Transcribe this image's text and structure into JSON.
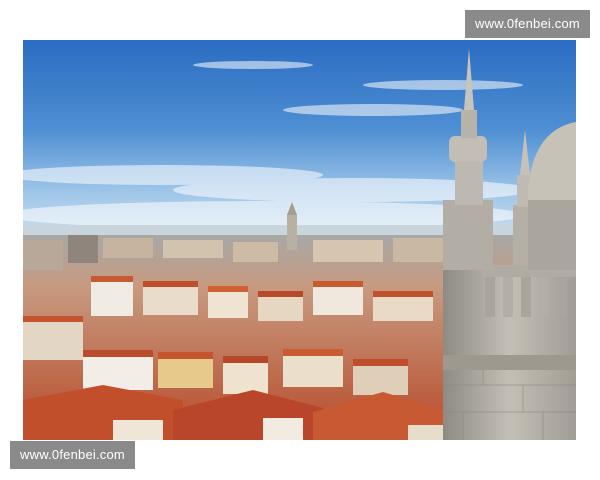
{
  "watermark": {
    "top_text": "www.0fenbei.com",
    "bottom_text": "www.0fenbei.com"
  },
  "photo": {
    "scene": "city-panorama",
    "colors": {
      "sky_top": "#2c6fc4",
      "sky_horizon": "#b9d6ee",
      "roof": "#c8552e",
      "wall": "#efe7da",
      "stone": "#b7b3aa"
    }
  }
}
